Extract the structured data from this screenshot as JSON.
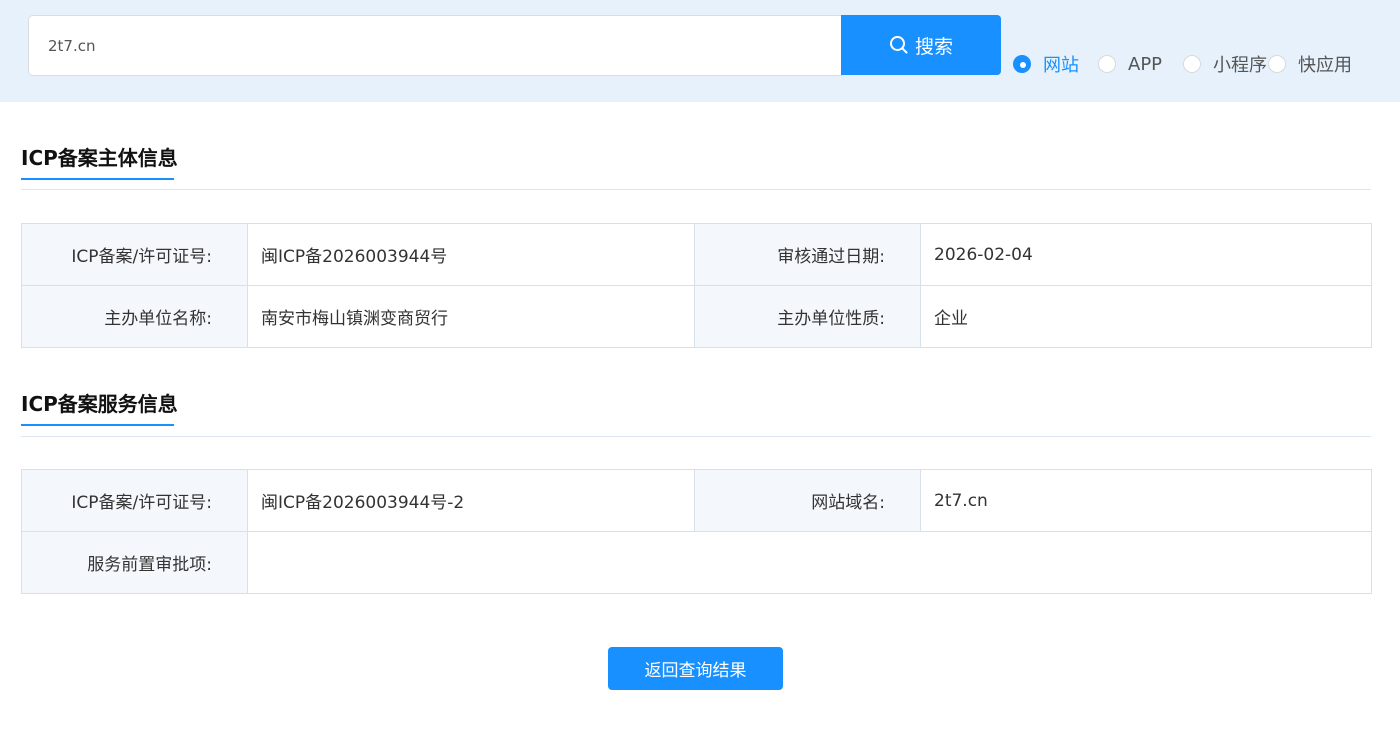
{
  "search": {
    "value": "2t7.cn",
    "placeholder": "",
    "button_label": "搜索",
    "icon": "search-icon"
  },
  "type_filter": {
    "selected": "网站",
    "options": [
      {
        "label": "网站",
        "checked": true
      },
      {
        "label": "APP",
        "checked": false
      },
      {
        "label": "小程序",
        "checked": false
      },
      {
        "label": "快应用",
        "checked": false
      }
    ]
  },
  "entity_info": {
    "title": "ICP备案主体信息",
    "license_label": "ICP备案/许可证号:",
    "license_value": "闽ICP备2026003944号",
    "approval_date_label": "审核通过日期:",
    "approval_date_value": "2026-02-04",
    "organizer_name_label": "主办单位名称:",
    "organizer_name_value": "南安市梅山镇渊变商贸行",
    "organizer_type_label": "主办单位性质:",
    "organizer_type_value": "企业"
  },
  "service_info": {
    "title": "ICP备案服务信息",
    "license_label": "ICP备案/许可证号:",
    "license_value": "闽ICP备2026003944号-2",
    "domain_label": "网站域名:",
    "domain_value": "2t7.cn",
    "pre_approval_label": "服务前置审批项:",
    "pre_approval_value": ""
  },
  "back_button_label": "返回查询结果",
  "colors": {
    "accent": "#1890ff",
    "band_background": "#e6f1fc",
    "label_cell_background": "#f4f8fc",
    "border": "#d8e1ea"
  }
}
